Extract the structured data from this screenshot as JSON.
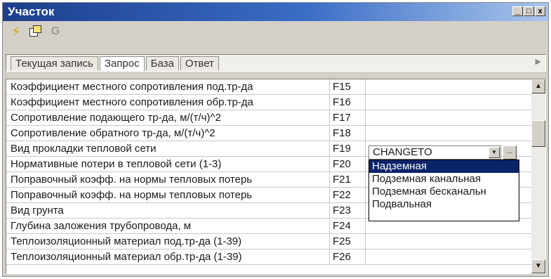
{
  "window": {
    "title": "Участок",
    "controls": [
      "_",
      "□",
      "x"
    ]
  },
  "toolbar": {
    "icons": [
      "lightning-icon",
      "copy-icon",
      "refresh-icon"
    ],
    "refresh_glyph": "G"
  },
  "tabs": {
    "items": [
      "Текущая запись",
      "Запрос",
      "База",
      "Ответ"
    ],
    "active": "Запрос"
  },
  "grid": {
    "rows": [
      {
        "name": "Коэффициент местного сопротивления под.тр-да",
        "code": "F15"
      },
      {
        "name": "Коэффициент местного сопротивления обр.тр-да",
        "code": "F16"
      },
      {
        "name": "Сопротивление подающего тр-да, м/(т/ч)^2",
        "code": "F17"
      },
      {
        "name": "Сопротивление обратного тр-да, м/(т/ч)^2",
        "code": "F18"
      },
      {
        "name": "Вид прокладки тепловой сети",
        "code": "F19"
      },
      {
        "name": "Нормативные потери в тепловой сети (1-3)",
        "code": "F20"
      },
      {
        "name": "Поправочный коэфф. на нормы тепловых потерь",
        "code": "F21"
      },
      {
        "name": "Поправочный коэфф. на нормы тепловых потерь",
        "code": "F22"
      },
      {
        "name": "Вид грунта",
        "code": "F23"
      },
      {
        "name": "Глубина заложения трубопровода, м",
        "code": "F24"
      },
      {
        "name": "Теплоизоляционный материал под.тр-да (1-39)",
        "code": "F25"
      },
      {
        "name": "Теплоизоляционный материал обр.тр-да (1-39)",
        "code": "F26"
      }
    ]
  },
  "combo": {
    "value": "CHANGETO",
    "options": [
      "Надземная",
      "Подземная канальная",
      "Подземная бесканальн",
      "Подвальная"
    ],
    "selected": "Надземная"
  },
  "colors": {
    "title_bar": "#1c3f8c",
    "selection": "#0a246a"
  }
}
